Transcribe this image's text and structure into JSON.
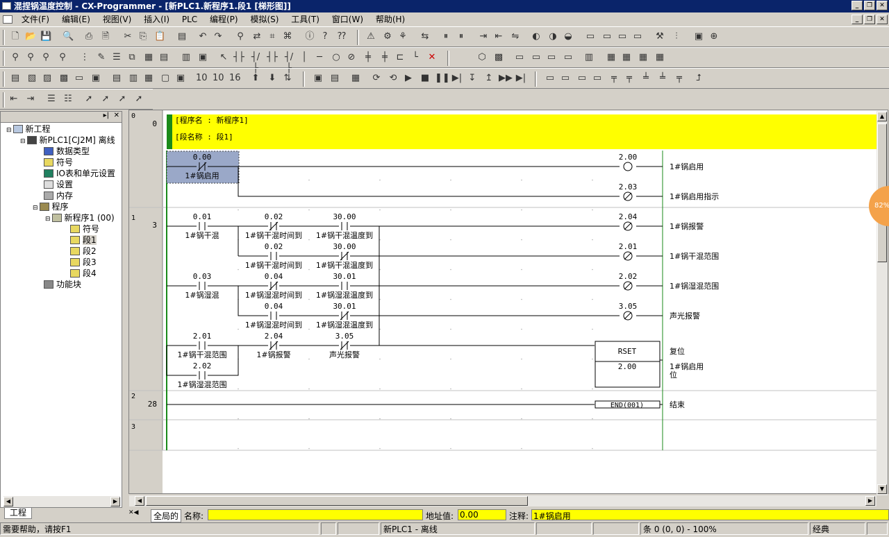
{
  "window": {
    "title": "混捏锅温度控制 - CX-Programmer - [新PLC1.新程序1.段1 [梯形图]]"
  },
  "menu": [
    "文件(F)",
    "编辑(E)",
    "视图(V)",
    "插入(I)",
    "PLC",
    "编程(P)",
    "模拟(S)",
    "工具(T)",
    "窗口(W)",
    "帮助(H)"
  ],
  "tree": {
    "items": [
      {
        "label": "新工程",
        "icon": "project-icon"
      },
      {
        "label": "新PLC1[CJ2M] 离线",
        "icon": "plc-icon"
      },
      {
        "label": "数据类型",
        "icon": "datatype-icon"
      },
      {
        "label": "符号",
        "icon": "symbols-icon"
      },
      {
        "label": "IO表和单元设置",
        "icon": "io-table-icon"
      },
      {
        "label": "设置",
        "icon": "settings-icon"
      },
      {
        "label": "内存",
        "icon": "memory-icon"
      },
      {
        "label": "程序",
        "icon": "programs-icon"
      },
      {
        "label": "新程序1 (00)",
        "icon": "program-icon"
      },
      {
        "label": "符号",
        "icon": "symbols-icon"
      },
      {
        "label": "段1",
        "icon": "section-icon"
      },
      {
        "label": "段2",
        "icon": "section-icon"
      },
      {
        "label": "段3",
        "icon": "section-icon"
      },
      {
        "label": "段4",
        "icon": "section-icon"
      },
      {
        "label": "功能块",
        "icon": "function-block-icon"
      }
    ],
    "tab": "工程"
  },
  "ladder": {
    "header": {
      "program": "[程序名 : 新程序1]",
      "section": "[段名称 : 段1]"
    },
    "rungs": [
      {
        "index": "0",
        "step": "0"
      },
      {
        "index": "1",
        "step": "3"
      },
      {
        "index": "2",
        "step": "28"
      },
      {
        "index": "3",
        "step": ""
      }
    ],
    "contacts": [
      {
        "addr": "0.00",
        "comment": "1#锅启用",
        "type": "nc",
        "selected": true
      },
      {
        "addr": "0.01",
        "comment": "1#锅干混",
        "type": "no"
      },
      {
        "addr": "0.02",
        "comment": "1#锅干混时间到",
        "type": "nc"
      },
      {
        "addr": "30.00",
        "comment": "1#锅干混温度到",
        "type": "no"
      },
      {
        "addr": "0.02",
        "comment": "1#锅干混时间到",
        "type": "no"
      },
      {
        "addr": "30.00",
        "comment": "1#锅干混温度到",
        "type": "nc"
      },
      {
        "addr": "0.03",
        "comment": "1#锅湿混",
        "type": "no"
      },
      {
        "addr": "0.04",
        "comment": "1#锅湿混时间到",
        "type": "nc"
      },
      {
        "addr": "30.01",
        "comment": "1#锅湿混温度到",
        "type": "no"
      },
      {
        "addr": "0.04",
        "comment": "1#锅湿混时间到",
        "type": "no"
      },
      {
        "addr": "30.01",
        "comment": "1#锅湿混温度到",
        "type": "nc"
      },
      {
        "addr": "2.01",
        "comment": "1#锅干混范围",
        "type": "no"
      },
      {
        "addr": "2.04",
        "comment": "1#锅报警",
        "type": "nc"
      },
      {
        "addr": "3.05",
        "comment": "声光报警",
        "type": "nc"
      },
      {
        "addr": "2.02",
        "comment": "1#锅湿混范围",
        "type": "no"
      }
    ],
    "coils": [
      {
        "addr": "2.00",
        "comment": "1#锅启用",
        "type": "normal"
      },
      {
        "addr": "2.03",
        "comment": "1#锅启用指示",
        "type": "negated"
      },
      {
        "addr": "2.04",
        "comment": "1#锅报警",
        "type": "negated"
      },
      {
        "addr": "2.01",
        "comment": "1#锅干混范围",
        "type": "negated"
      },
      {
        "addr": "2.02",
        "comment": "1#锅湿混范围",
        "type": "negated"
      },
      {
        "addr": "3.05",
        "comment": "声光报警",
        "type": "negated"
      }
    ],
    "rset": {
      "label": "RSET",
      "operand": "2.00",
      "comment1": "复位",
      "comment2a": "1#锅启用",
      "comment2b": "位"
    },
    "end": {
      "label": "END(001)",
      "comment": "结束"
    }
  },
  "bottombar": {
    "tab": "全局的",
    "name_label": "名称:",
    "name_value": "",
    "addr_label": "地址值:",
    "addr_value": "0.00",
    "comment_label": "注释:",
    "comment_value": "1#锅启用"
  },
  "status": {
    "help": "需要帮助，请按F1",
    "plc": "新PLC1 - 离线",
    "pos": "条 0 (0, 0) - 100%",
    "mode": "经典"
  },
  "badge": "82%",
  "colors": {
    "title_bg": "#0a246a",
    "header_yellow": "#ffff00",
    "rung_green": "#1a8a1a",
    "selection": "#9aa8c8",
    "face": "#d4d0c8"
  }
}
